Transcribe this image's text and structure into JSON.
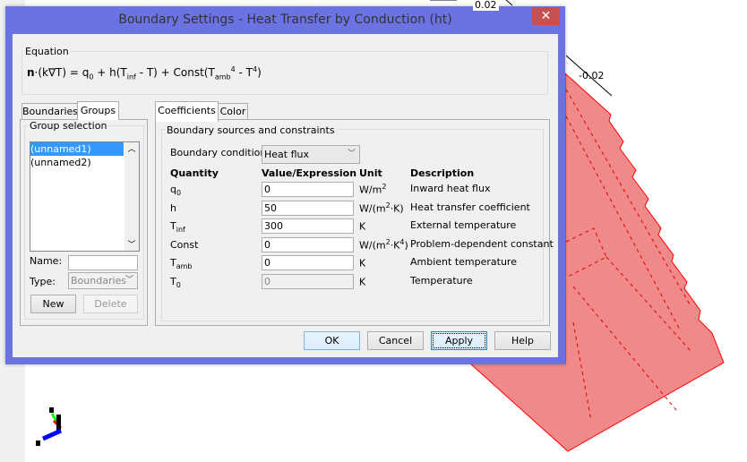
{
  "window": {
    "title": "Boundary Settings - Heat Transfer by Conduction (ht)",
    "close_icon": "close-icon"
  },
  "equation": {
    "label": "Equation",
    "lhs": "n",
    "mid": "·(k∇T) = q",
    "s1": "0",
    "p2": " + h(T",
    "s2": "inf",
    "p3": " - T) + Const(T",
    "s3": "amb",
    "sup1": "4",
    "p4": " - T",
    "sup2": "4",
    "p5": ")"
  },
  "left_tabs": [
    {
      "label": "Boundaries"
    },
    {
      "label": "Groups",
      "active": true
    }
  ],
  "groups": {
    "label": "Group selection",
    "items": [
      {
        "label": "(unnamed1)",
        "selected": true
      },
      {
        "label": "(unnamed2)"
      }
    ],
    "name_label": "Name:",
    "name_value": "",
    "type_label": "Type:",
    "type_value": "Boundaries",
    "new_label": "New",
    "delete_label": "Delete"
  },
  "right_tabs": [
    {
      "label": "Coefficients",
      "active": true
    },
    {
      "label": "Color"
    }
  ],
  "coefficients": {
    "group_label": "Boundary sources and constraints",
    "bc_label": "Boundary condition:",
    "bc_value": "Heat flux",
    "headers": {
      "quantity": "Quantity",
      "value": "Value/Expression",
      "unit": "Unit",
      "description": "Description"
    },
    "rows": [
      {
        "q": "q",
        "qs": "0",
        "value": "0",
        "unit": "W/m",
        "usup": "2",
        "unit2": "",
        "desc": "Inward heat flux"
      },
      {
        "q": "h",
        "qs": "",
        "value": "50",
        "unit": "W/(m",
        "usup": "2",
        "unit2": "·K)",
        "desc": "Heat transfer coefficient"
      },
      {
        "q": "T",
        "qs": "inf",
        "value": "300",
        "unit": "K",
        "usup": "",
        "unit2": "",
        "desc": "External temperature"
      },
      {
        "q": "Const",
        "qs": "",
        "value": "0",
        "unit": "W/(m",
        "usup": "2",
        "unit2": "·K",
        "usup2": "4",
        "unit3": ")",
        "desc": "Problem-dependent constant"
      },
      {
        "q": "T",
        "qs": "amb",
        "value": "0",
        "unit": "K",
        "usup": "",
        "unit2": "",
        "desc": "Ambient temperature"
      },
      {
        "q": "T",
        "qs": "0",
        "value": "0",
        "unit": "K",
        "usup": "",
        "unit2": "",
        "desc": "Temperature",
        "disabled": true
      }
    ]
  },
  "buttons": {
    "ok": "OK",
    "cancel": "Cancel",
    "apply": "Apply",
    "help": "Help"
  },
  "canvas": {
    "axis_label_1": "-0.02",
    "axis_label_2": "0.02",
    "object_color": "#f08a8a",
    "edge_color": "#ff0000"
  }
}
